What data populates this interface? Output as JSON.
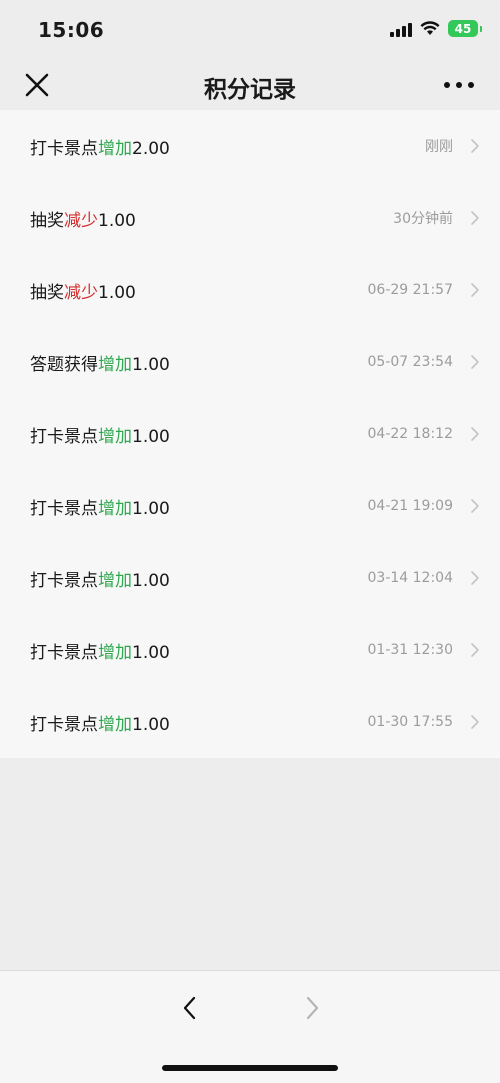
{
  "status": {
    "time": "15:06",
    "battery": "45"
  },
  "nav": {
    "title": "积分记录"
  },
  "records": [
    {
      "action": "打卡景点",
      "delta_label": "增加",
      "delta_type": "up",
      "amount": "2.00",
      "time": "刚刚"
    },
    {
      "action": "抽奖",
      "delta_label": "减少",
      "delta_type": "down",
      "amount": "1.00",
      "time": "30分钟前"
    },
    {
      "action": "抽奖",
      "delta_label": "减少",
      "delta_type": "down",
      "amount": "1.00",
      "time": "06-29 21:57"
    },
    {
      "action": "答题获得",
      "delta_label": "增加",
      "delta_type": "up",
      "amount": "1.00",
      "time": "05-07 23:54"
    },
    {
      "action": "打卡景点",
      "delta_label": "增加",
      "delta_type": "up",
      "amount": "1.00",
      "time": "04-22 18:12"
    },
    {
      "action": "打卡景点",
      "delta_label": "增加",
      "delta_type": "up",
      "amount": "1.00",
      "time": "04-21 19:09"
    },
    {
      "action": "打卡景点",
      "delta_label": "增加",
      "delta_type": "up",
      "amount": "1.00",
      "time": "03-14 12:04"
    },
    {
      "action": "打卡景点",
      "delta_label": "增加",
      "delta_type": "up",
      "amount": "1.00",
      "time": "01-31 12:30"
    },
    {
      "action": "打卡景点",
      "delta_label": "增加",
      "delta_type": "up",
      "amount": "1.00",
      "time": "01-30 17:55"
    }
  ],
  "colors": {
    "increase": "#2fa84f",
    "decrease": "#d32c2c"
  }
}
